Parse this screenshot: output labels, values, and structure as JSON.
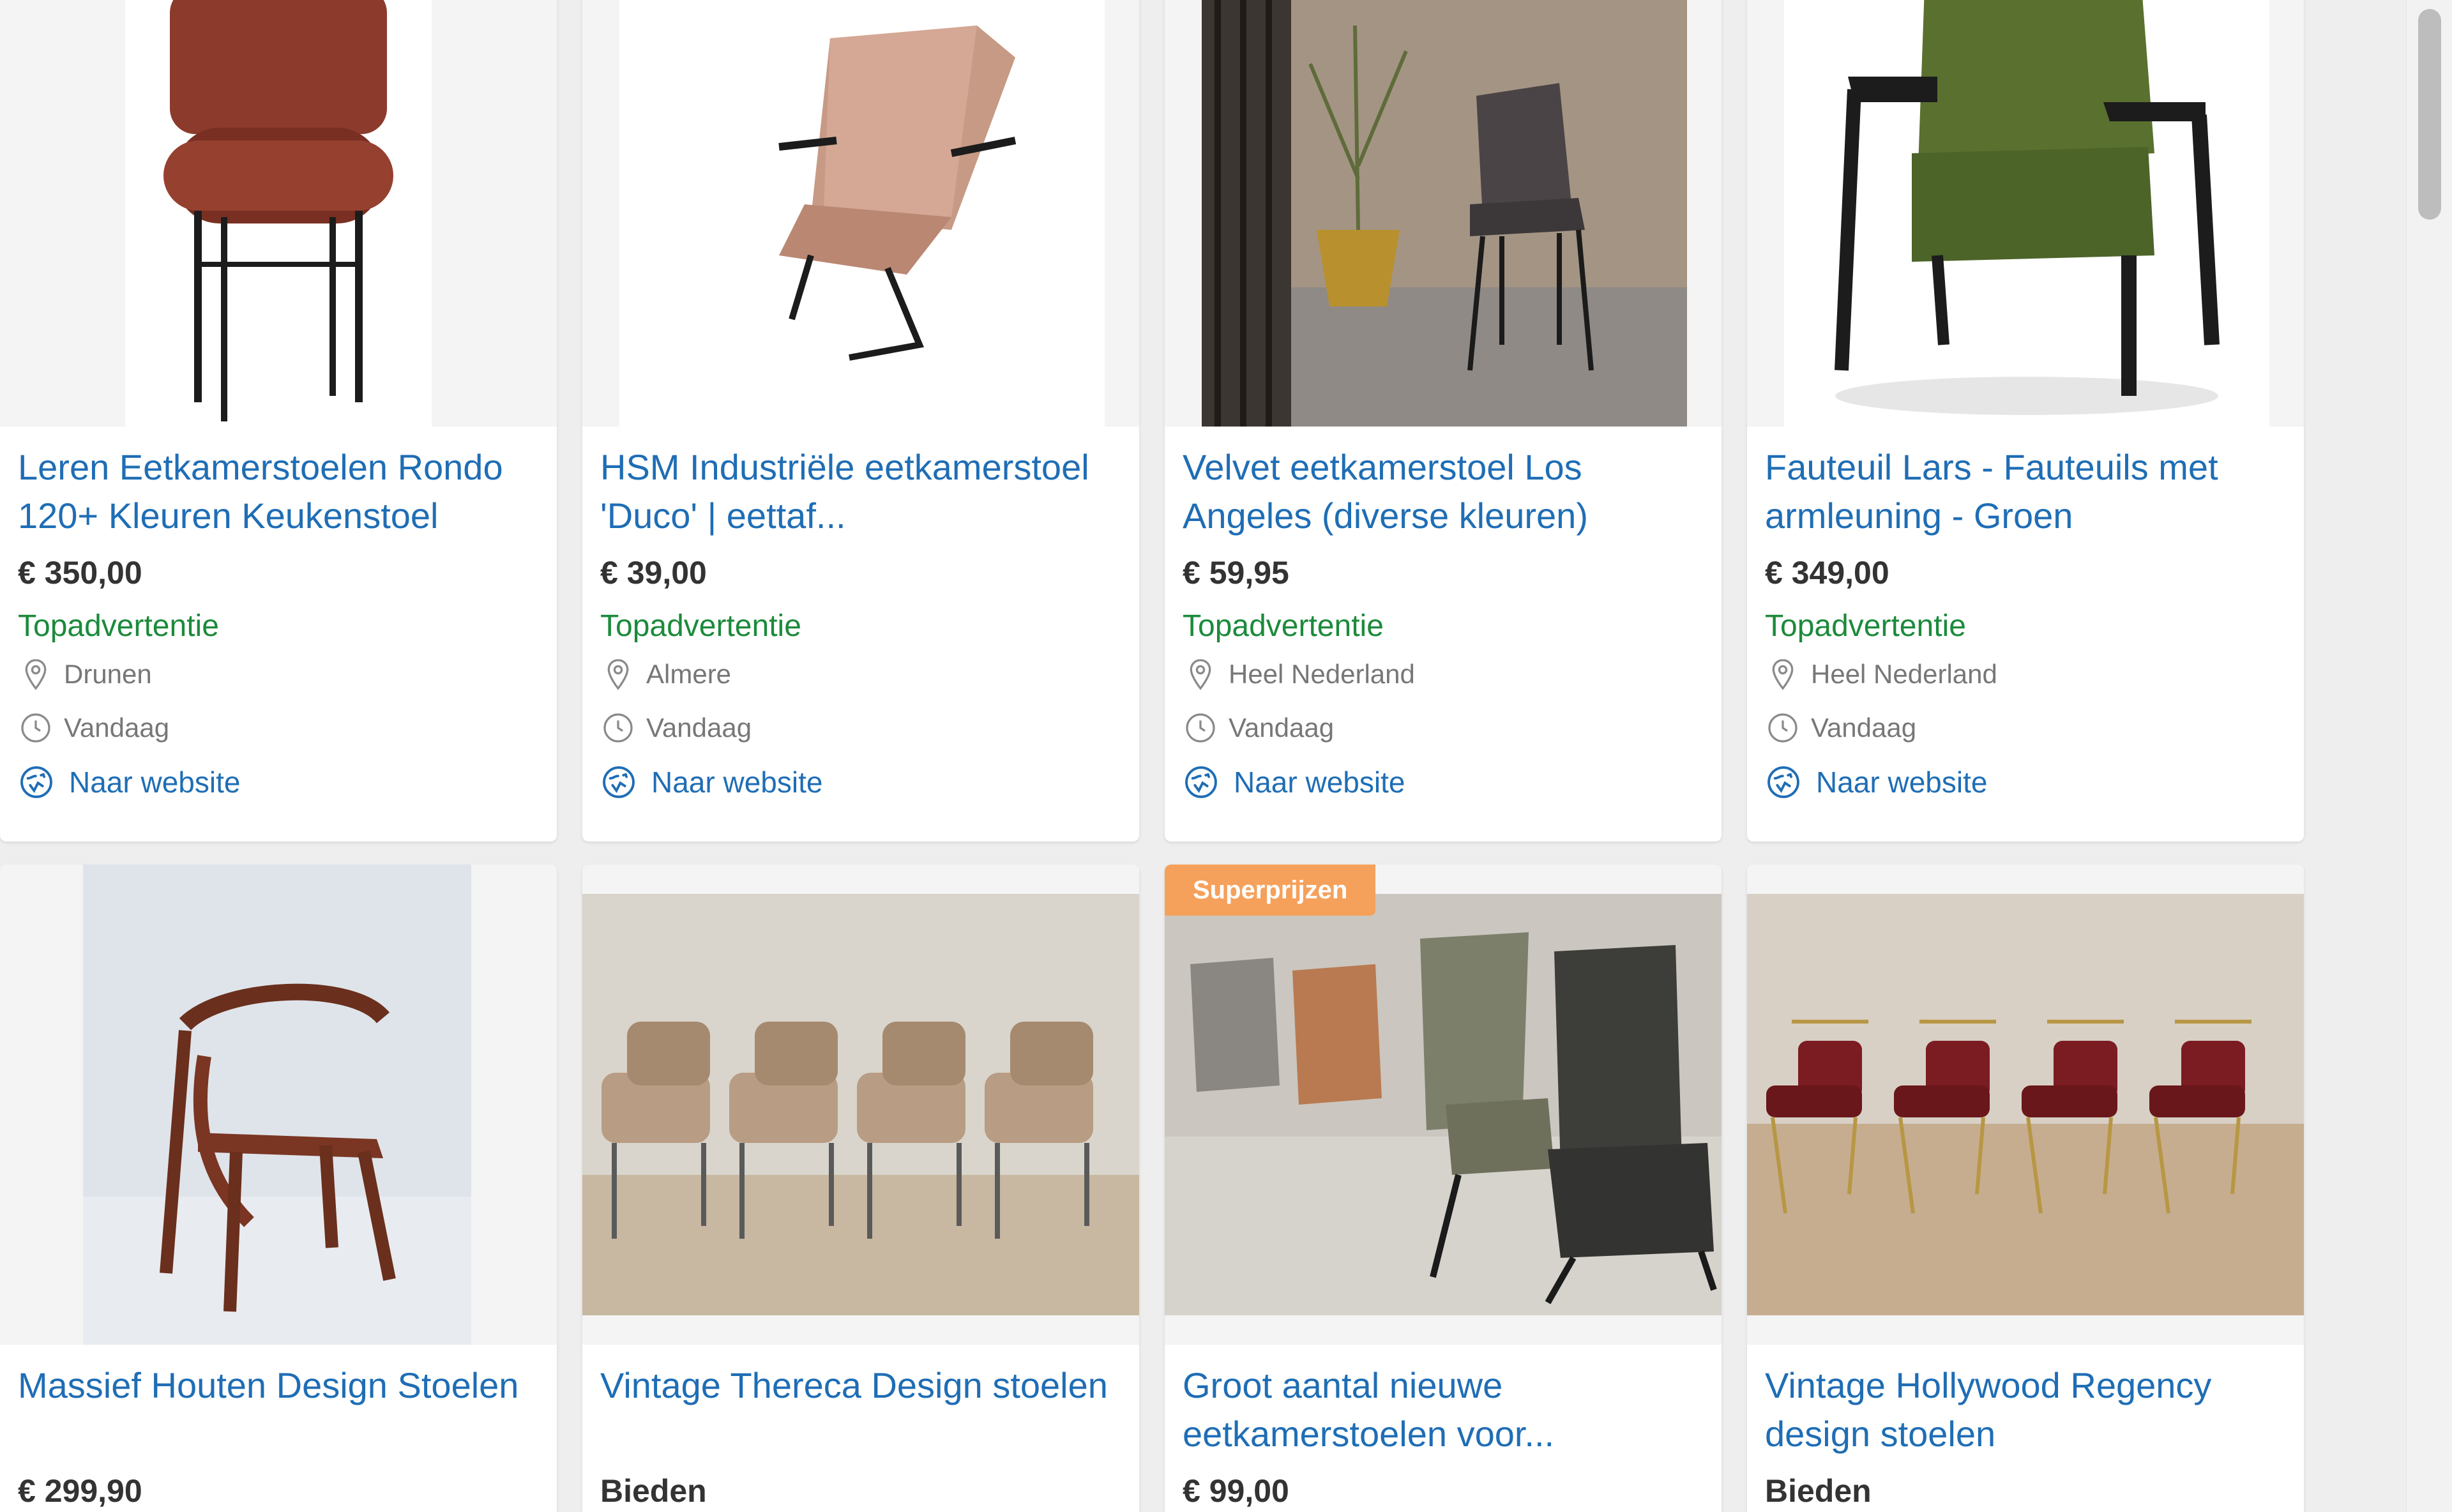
{
  "listings": [
    {
      "title": "Leren Eetkamerstoelen Rondo 120+ Kleuren Keukenstoel",
      "price": "€ 350,00",
      "tag": "Topadvertentie",
      "location": "Drunen",
      "date": "Vandaag",
      "link": "Naar website"
    },
    {
      "title": "HSM Industriële eetkamerstoel 'Duco' | eettaf...",
      "price": "€ 39,00",
      "tag": "Topadvertentie",
      "location": "Almere",
      "date": "Vandaag",
      "link": "Naar website"
    },
    {
      "title": "Velvet eetkamerstoel Los Angeles (diverse kleuren)",
      "price": "€ 59,95",
      "tag": "Topadvertentie",
      "location": "Heel Nederland",
      "date": "Vandaag",
      "link": "Naar website"
    },
    {
      "title": "Fauteuil Lars - Fauteuils met armleuning - Groen",
      "price": "€ 349,00",
      "tag": "Topadvertentie",
      "location": "Heel Nederland",
      "date": "Vandaag",
      "link": "Naar website"
    },
    {
      "title": "Massief Houten Design Stoelen",
      "price": "€ 299,90"
    },
    {
      "title": "Vintage Thereca Design stoelen",
      "price": "Bieden"
    },
    {
      "badge": "Superprijzen",
      "title": "Groot aantal nieuwe eetkamerstoelen voor...",
      "price": "€ 99,00"
    },
    {
      "title": "Vintage Hollywood Regency design stoelen",
      "price": "Bieden"
    }
  ],
  "colors": {
    "title": "#1f6eb5",
    "topad": "#1b8a3a",
    "badge": "#f6a15b"
  },
  "icons": {
    "location": "map-pin-icon",
    "date": "clock-icon",
    "link": "external-website-icon"
  }
}
